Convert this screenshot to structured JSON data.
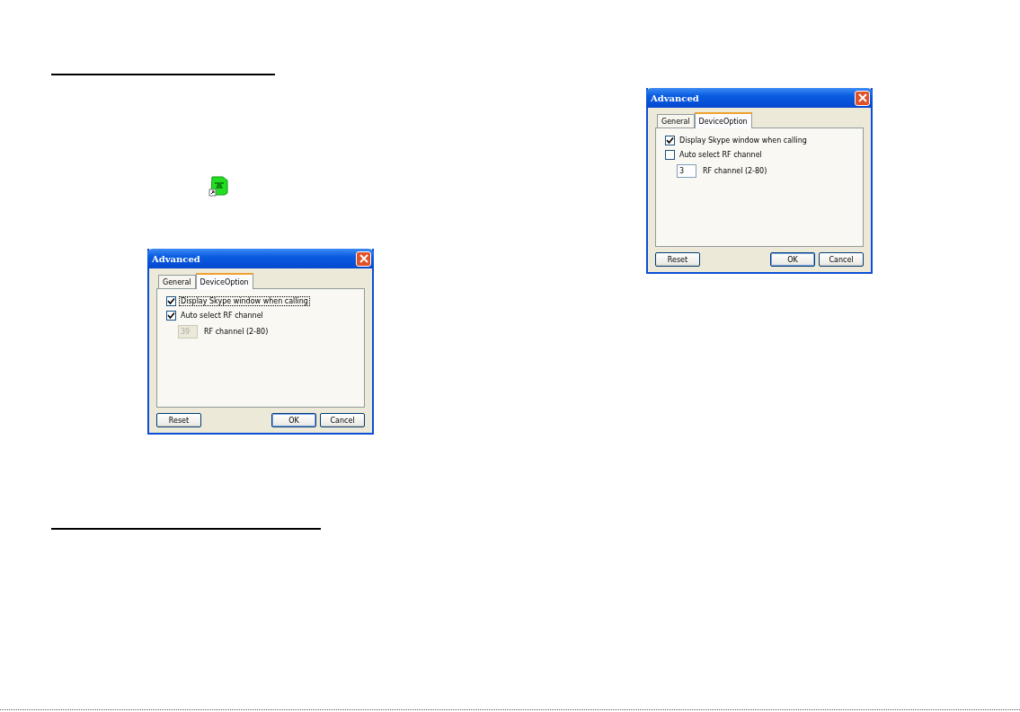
{
  "dialogs": [
    {
      "title": "Advanced",
      "tabs": [
        {
          "label": "General",
          "selected": false
        },
        {
          "label": "DeviceOption",
          "selected": true
        }
      ],
      "options": [
        {
          "kind": "checkbox",
          "label": "Display Skype window when calling",
          "checked": true,
          "focused": true
        },
        {
          "kind": "checkbox",
          "label": "Auto select RF channel",
          "checked": true,
          "focused": false
        }
      ],
      "channel": {
        "value": "39",
        "label": "RF channel (2-80)",
        "disabled": true
      },
      "buttons": [
        {
          "label": "Reset",
          "default": false
        },
        {
          "label": "OK",
          "default": true
        },
        {
          "label": "Cancel",
          "default": false
        }
      ]
    },
    {
      "title": "Advanced",
      "tabs": [
        {
          "label": "General",
          "selected": false
        },
        {
          "label": "DeviceOption",
          "selected": true
        }
      ],
      "options": [
        {
          "kind": "checkbox",
          "label": "Display Skype window when calling",
          "checked": true,
          "focused": false
        },
        {
          "kind": "checkbox",
          "label": "Auto select RF channel",
          "checked": false,
          "focused": false
        }
      ],
      "channel": {
        "value": "3",
        "label": "RF channel (2-80)",
        "disabled": false
      },
      "buttons": [
        {
          "label": "Reset",
          "default": false
        },
        {
          "label": "OK",
          "default": true
        },
        {
          "label": "Cancel",
          "default": false
        }
      ]
    }
  ]
}
